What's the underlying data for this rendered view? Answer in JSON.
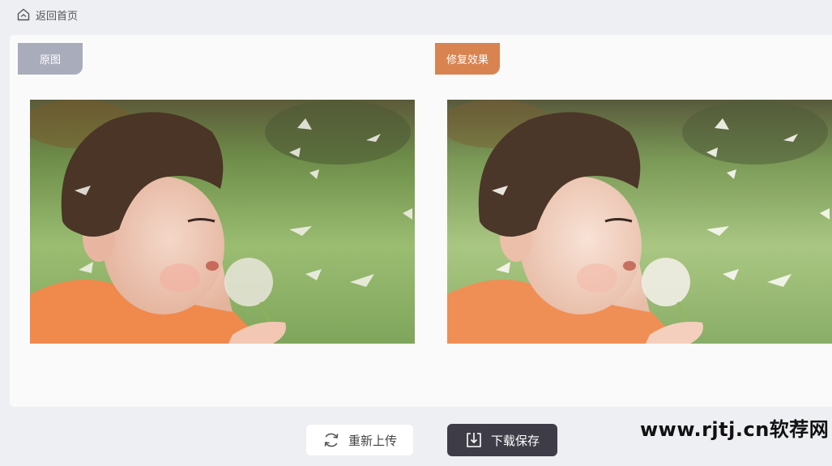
{
  "topbar": {
    "back_label": "返回首页"
  },
  "panels": {
    "original_tag": "原图",
    "result_tag": "修复效果"
  },
  "actions": {
    "reupload_label": "重新上传",
    "save_label": "下载保存"
  },
  "watermark": {
    "text": "www.rjtj.cn软荐网"
  },
  "colors": {
    "original_tag_bg": "#a9acbb",
    "result_tag_bg": "#d98350",
    "save_button_bg": "#3e3d47",
    "page_bg": "#eeeff3"
  },
  "images": {
    "original": "photo-of-boy-blowing-dandelion",
    "result": "restored-photo-of-boy-blowing-dandelion"
  }
}
